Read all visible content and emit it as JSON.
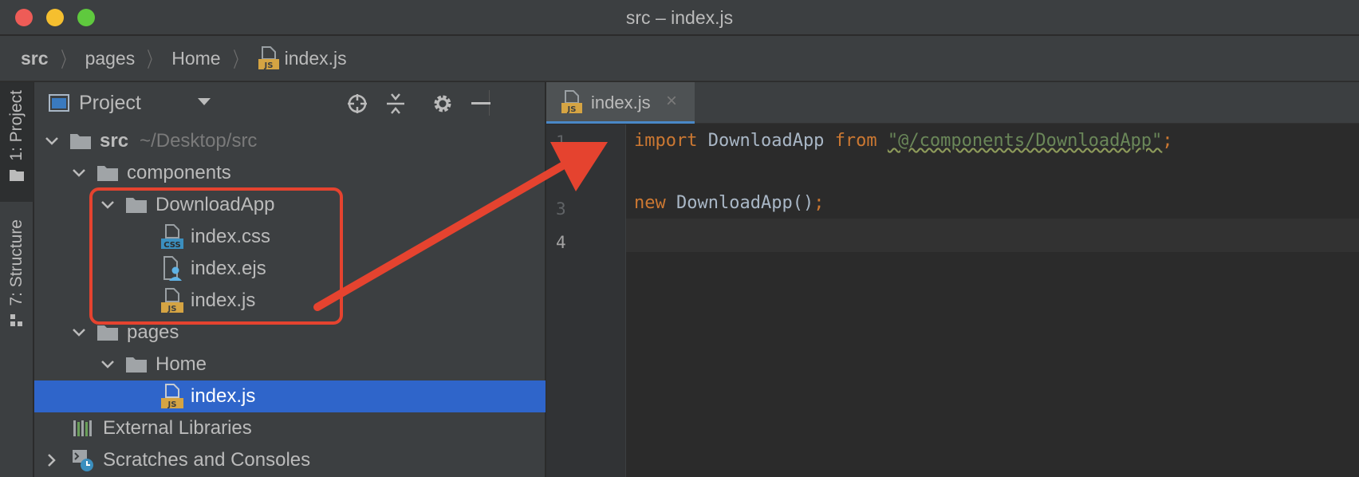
{
  "window": {
    "title": "src – index.js"
  },
  "breadcrumb": {
    "items": [
      "src",
      "pages",
      "Home"
    ],
    "file": "index.js",
    "file_badge": "JS"
  },
  "toolstrip": {
    "project_label": "1: Project",
    "structure_label": "7: Structure"
  },
  "project_panel": {
    "title": "Project",
    "tree": [
      {
        "label": "src",
        "hint": "~/Desktop/src",
        "type": "folder",
        "expanded": true,
        "bold": true
      },
      {
        "label": "components",
        "type": "folder",
        "expanded": true
      },
      {
        "label": "DownloadApp",
        "type": "folder",
        "expanded": true
      },
      {
        "label": "index.css",
        "type": "css"
      },
      {
        "label": "index.ejs",
        "type": "ejs"
      },
      {
        "label": "index.js",
        "type": "js"
      },
      {
        "label": "pages",
        "type": "folder",
        "expanded": true
      },
      {
        "label": "Home",
        "type": "folder",
        "expanded": true
      },
      {
        "label": "index.js",
        "type": "js",
        "selected": true
      },
      {
        "label": "External Libraries",
        "type": "libraries"
      },
      {
        "label": "Scratches and Consoles",
        "type": "scratches",
        "collapsed": true
      }
    ]
  },
  "editor": {
    "tab": {
      "label": "index.js",
      "badge": "JS",
      "close": "×"
    },
    "line_numbers": [
      "1",
      "3",
      "4"
    ],
    "code": {
      "line1": {
        "kw1": "import",
        "id1": "DownloadApp",
        "kw2": "from",
        "str": "\"@/components/DownloadApp\"",
        "end": ";"
      },
      "line3": {
        "kw1": "new",
        "id1": "DownloadApp",
        "paren": "()",
        "end": ";"
      }
    }
  },
  "file_badges": {
    "js": "JS",
    "css": "CSS"
  },
  "colors": {
    "annotation": "#e5432f",
    "selection": "#2f65ca",
    "keyword": "#cc7832",
    "string": "#6a8759"
  }
}
